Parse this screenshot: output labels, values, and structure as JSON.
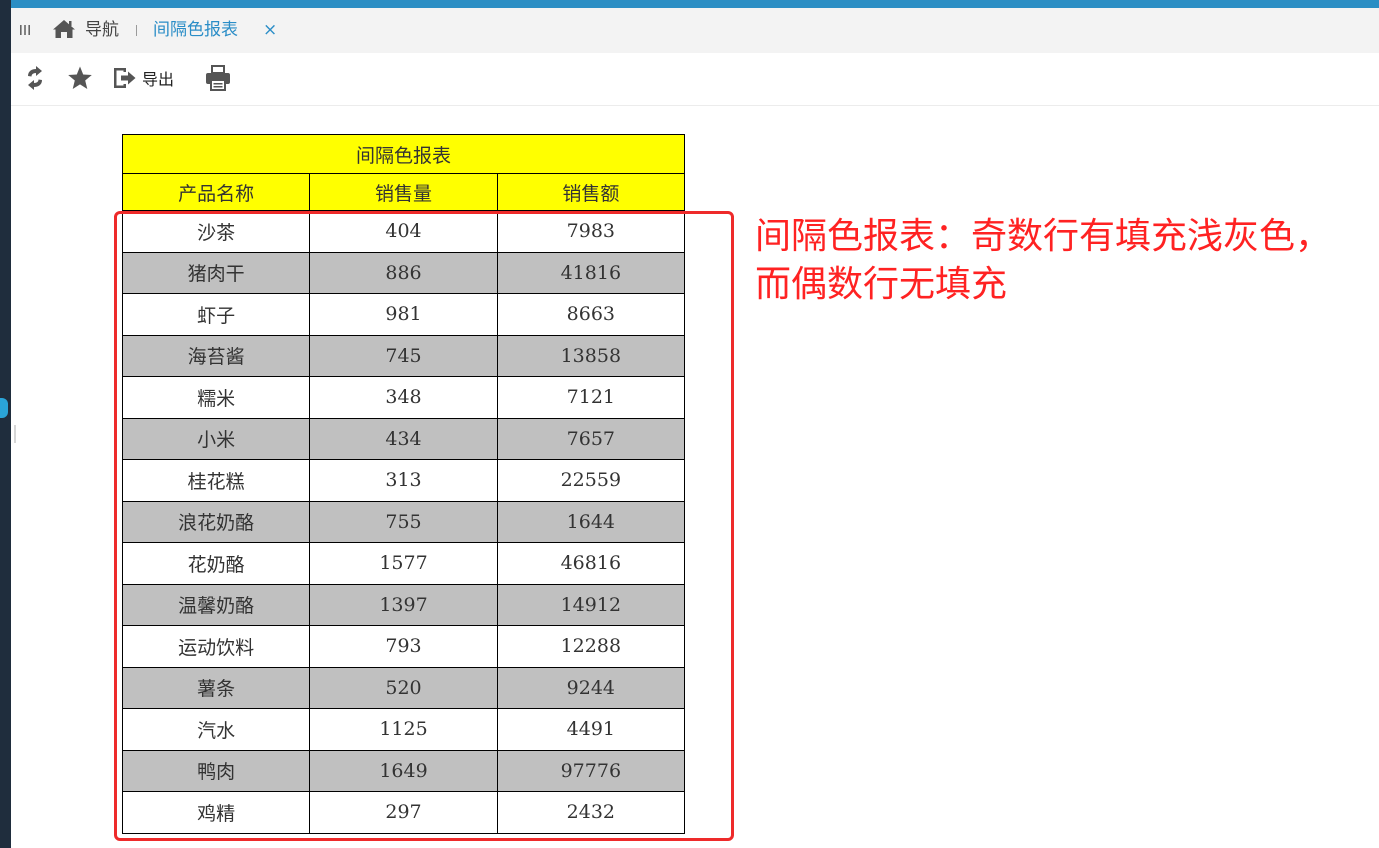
{
  "tabbar": {
    "nav_label": "导航",
    "active_tab": "间隔色报表",
    "close_symbol": "×",
    "icons": [
      "menu-icon",
      "home-icon",
      "close-icon"
    ]
  },
  "toolbar": {
    "export_label": "导出",
    "icons": [
      "refresh-icon",
      "star-icon",
      "export-icon",
      "print-icon"
    ]
  },
  "report": {
    "title": "间隔色报表",
    "headers": [
      "产品名称",
      "销售量",
      "销售额"
    ],
    "rows": [
      [
        "沙茶",
        "404",
        "7983"
      ],
      [
        "猪肉干",
        "886",
        "41816"
      ],
      [
        "虾子",
        "981",
        "8663"
      ],
      [
        "海苔酱",
        "745",
        "13858"
      ],
      [
        "糯米",
        "348",
        "7121"
      ],
      [
        "小米",
        "434",
        "7657"
      ],
      [
        "桂花糕",
        "313",
        "22559"
      ],
      [
        "浪花奶酪",
        "755",
        "1644"
      ],
      [
        "花奶酪",
        "1577",
        "46816"
      ],
      [
        "温馨奶酪",
        "1397",
        "14912"
      ],
      [
        "运动饮料",
        "793",
        "12288"
      ],
      [
        "薯条",
        "520",
        "9244"
      ],
      [
        "汽水",
        "1125",
        "4491"
      ],
      [
        "鸭肉",
        "1649",
        "97776"
      ],
      [
        "鸡精",
        "297",
        "2432"
      ]
    ],
    "colors": {
      "header_fill": "#ffff00",
      "alternate_row_fill": "#c0c0c0",
      "row_fill": "#ffffff"
    }
  },
  "annotation": {
    "line1": "间隔色报表：奇数行有填充浅灰色，",
    "line2": "而偶数行无填充",
    "color": "#ff2222"
  },
  "colors": {
    "accent": "#2a8dc7",
    "top_bar": "#2b8ec4"
  }
}
